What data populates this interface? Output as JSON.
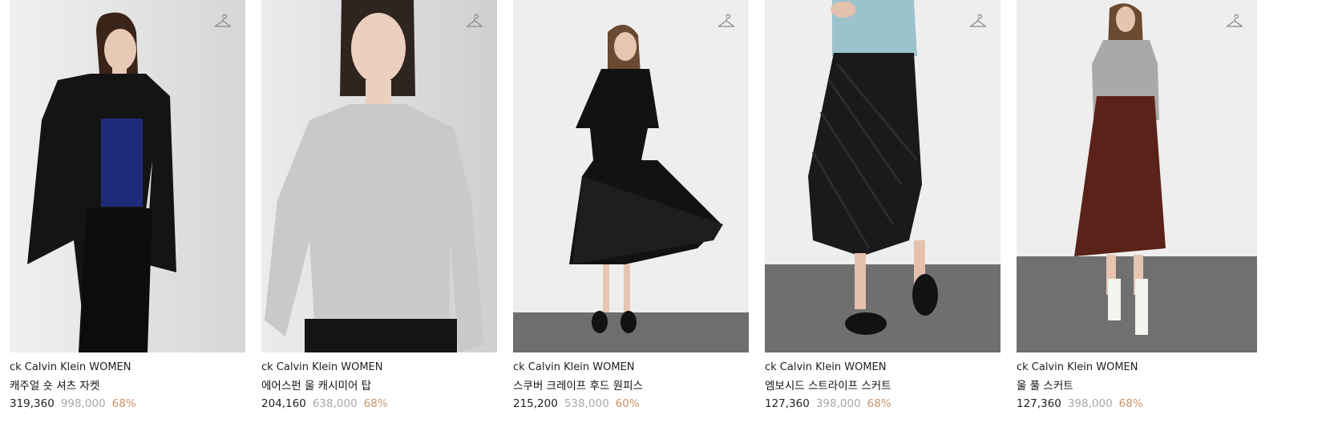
{
  "products": [
    {
      "brand": "ck Calvin Klein WOMEN",
      "name": "캐주얼 숏 셔츠 자켓",
      "price": "319,360",
      "original_price": "998,000",
      "discount": "68%",
      "icon": "hanger-icon",
      "colors": {
        "bg": "#e9e9e9",
        "garment": "#141414",
        "accent": "#1e2a7a",
        "skin": "#e8c9b5",
        "hair": "#3a2418"
      }
    },
    {
      "brand": "ck Calvin Klein WOMEN",
      "name": "에어스펀 울 캐시미어 탑",
      "price": "204,160",
      "original_price": "638,000",
      "discount": "68%",
      "icon": "hanger-icon",
      "colors": {
        "bg": "#e6e6e6",
        "garment": "#c8c9cb",
        "accent": "#141414",
        "skin": "#ecd0bf",
        "hair": "#2e2420"
      }
    },
    {
      "brand": "ck Calvin Klein WOMEN",
      "name": "스쿠버 크레이프 후드 원피스",
      "price": "215,200",
      "original_price": "538,000",
      "discount": "60%",
      "icon": "hanger-icon",
      "colors": {
        "bg": "#ececec",
        "garment": "#121212",
        "accent": "#121212",
        "skin": "#e6c6b2",
        "hair": "#6a4a33"
      }
    },
    {
      "brand": "ck Calvin Klein WOMEN",
      "name": "엠보시드 스트라이프 스커트",
      "price": "127,360",
      "original_price": "398,000",
      "discount": "68%",
      "icon": "hanger-icon",
      "colors": {
        "bg": "#ececec",
        "garment": "#1a1a1a",
        "accent": "#9cc2cc",
        "skin": "#e3c1ad",
        "hair": "#000000"
      }
    },
    {
      "brand": "ck Calvin Klein WOMEN",
      "name": "울 풀 스커트",
      "price": "127,360",
      "original_price": "398,000",
      "discount": "68%",
      "icon": "hanger-icon",
      "colors": {
        "bg": "#ececec",
        "garment": "#5a2218",
        "accent": "#a9a9ab",
        "skin": "#e6c4b0",
        "hair": "#6b4a30"
      }
    }
  ]
}
